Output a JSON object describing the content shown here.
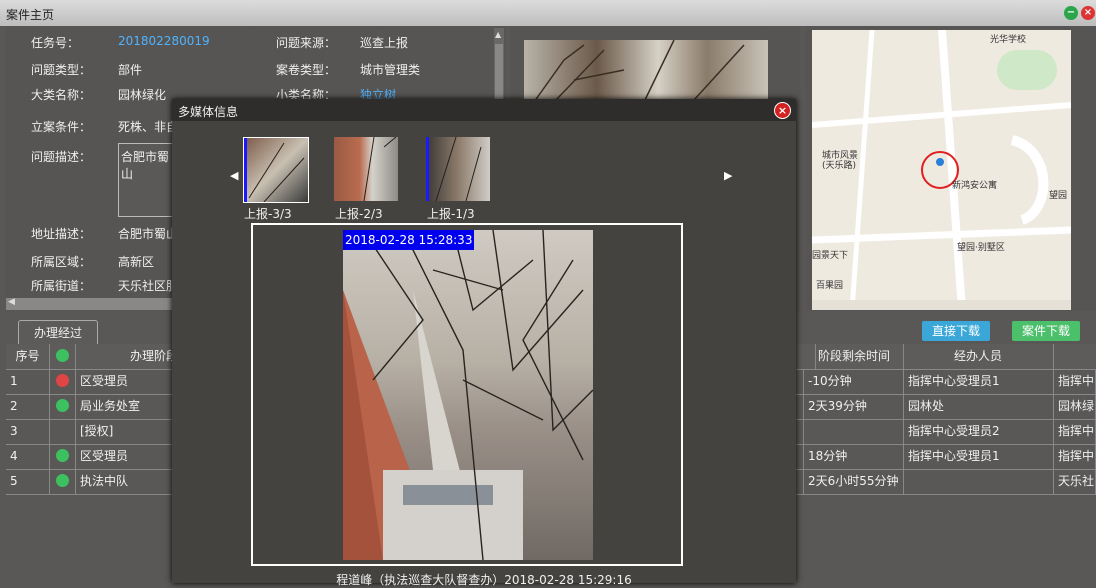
{
  "window": {
    "title": "案件主页"
  },
  "details": {
    "task_no_label": "任务号：",
    "task_no": "201802280019",
    "source_label": "问题来源：",
    "source": "巡查上报",
    "type_label": "问题类型：",
    "type": "部件",
    "case_type_label": "案卷类型：",
    "case_type": "城市管理类",
    "major_label": "大类名称：",
    "major": "园林绿化",
    "minor_label": "小类名称：",
    "minor": "独立树",
    "condition_label": "立案条件：",
    "condition": "死株、非自",
    "desc_label": "问题描述：",
    "desc": "合肥市蜀山",
    "address_label": "地址描述：",
    "address": "合肥市蜀山",
    "region_label": "所属区域：",
    "region": "高新区",
    "street_label": "所属街道：",
    "street": "天乐社区服"
  },
  "map": {
    "labels": [
      "城市风景",
      "(天乐路)",
      "新鸿安公寓",
      "望园",
      "望园·别墅区",
      "光华学校",
      "百果园",
      "园景天下"
    ]
  },
  "toolbar": {
    "direct_download": "直接下载",
    "case_download": "案件下载"
  },
  "tab": {
    "label": "办理经过"
  },
  "table": {
    "headers": [
      "序号",
      "办理阶段",
      "阶段剩余时间",
      "经办人员"
    ],
    "rows": [
      {
        "no": "1",
        "status": "red",
        "stage": "区受理员",
        "remain": "-10分钟",
        "person": "指挥中心受理员1",
        "extra": "指挥中"
      },
      {
        "no": "2",
        "status": "green",
        "stage": "局业务处室",
        "remain": "2天39分钟",
        "person": "园林处",
        "extra": "园林绿"
      },
      {
        "no": "3",
        "status": "none",
        "stage": "[授权]",
        "remain": "",
        "person": "指挥中心受理员2",
        "extra": "指挥中"
      },
      {
        "no": "4",
        "status": "green",
        "stage": "区受理员",
        "remain": "18分钟",
        "person": "指挥中心受理员1",
        "extra": "指挥中"
      },
      {
        "no": "5",
        "status": "green",
        "stage": "执法中队",
        "remain": "2天6小时55分钟",
        "person": "",
        "extra": "天乐社"
      }
    ]
  },
  "dialog": {
    "title": "多媒体信息",
    "thumbs": [
      "上报-3/3",
      "上报-2/3",
      "上报-1/3"
    ],
    "timestamp": "2018-02-28 15:28:33",
    "caption": "程道峰（执法巡查大队督查办）2018-02-28 15:29:16"
  },
  "colors": {
    "accent_blue": "#4fb3ff",
    "btn_blue": "#3aa7d8",
    "btn_green": "#4cbf6b",
    "red_status": "#e04545",
    "green_status": "#3cc060"
  }
}
